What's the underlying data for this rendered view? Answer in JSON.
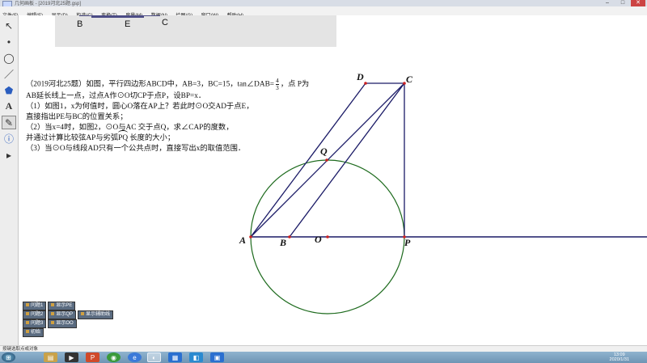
{
  "window": {
    "title": "几何画板 - [2019河北25题.gsp]",
    "controls": [
      "–",
      "□",
      "✕"
    ]
  },
  "menubar": {
    "items": [
      "文件(F)",
      "编辑(E)",
      "显示(D)",
      "构造(C)",
      "变换(T)",
      "度量(M)",
      "数据(N)",
      "绘图(G)",
      "窗口(W)",
      "帮助(H)"
    ]
  },
  "toolbox": {
    "tools": [
      {
        "name": "arrow-select-tool",
        "glyph": "↖"
      },
      {
        "name": "point-tool",
        "glyph": "•"
      },
      {
        "name": "compass-tool",
        "glyph": "◯"
      },
      {
        "name": "straightedge-tool",
        "glyph": "／"
      },
      {
        "name": "polygon-tool",
        "glyph": "⬟"
      },
      {
        "name": "text-tool",
        "glyph": "A"
      },
      {
        "name": "marker-tool",
        "glyph": "✎"
      },
      {
        "name": "information-tool",
        "glyph": "ⓘ"
      },
      {
        "name": "custom-tool",
        "glyph": "▸"
      }
    ]
  },
  "top_figure": {
    "labels": [
      "B",
      "E",
      "C"
    ]
  },
  "problem": {
    "line1_pre": "（2019河北25题）如图，平行四边形ABCD中，AB=3，BC=15，tan∠DAB=",
    "frac_num": "4",
    "frac_den": "3",
    "line1_post": "，点 P为",
    "line2": "AB延长线上一点，过点A作⊙O切CP于点P，设BP=x．",
    "line3": "（1）如图1，x为何值时，圆心O落在AP上？若此时⊙O交AD于点E，",
    "line4": "直接指出PE与BC的位置关系；",
    "line5": "（2）当x=4时，如图2，⊙O与AC 交于点Q，求∠CAP的度数，",
    "line6_pre": "并通过计算比较弦AP与劣弧",
    "line6_arc": "PQ",
    "line6_post": " 长度的大小；",
    "line7": "（3）当⊙O与线段AD只有一个公共点时，直接写出x的取值范围．"
  },
  "geometry_labels": {
    "A": "A",
    "B": "B",
    "C": "C",
    "D": "D",
    "O": "O",
    "P": "P",
    "Q": "Q"
  },
  "colors": {
    "segment": "#1a1a66",
    "circle": "#1e6b1e",
    "point": "#cc2222",
    "button_bg": "#5a6b80"
  },
  "action_buttons": {
    "row1": [
      "问题1",
      "显示PE"
    ],
    "row2": [
      "问题2",
      "显示QP",
      "显示辅助线"
    ],
    "row3": [
      "问题3",
      "显示OO"
    ],
    "row4": [
      "初始"
    ]
  },
  "status": {
    "text": "按键选取点或对象"
  },
  "taskbar": {
    "items": [
      "start-orb-icon",
      "file-explorer-icon",
      "media-player-icon",
      "presentation-icon",
      "chrome-icon",
      "browser-icon",
      "sketchpad-icon",
      "app-icon",
      "app-icon-2",
      "app-icon-3"
    ],
    "time": "13:09",
    "date": "2020/1/31"
  }
}
